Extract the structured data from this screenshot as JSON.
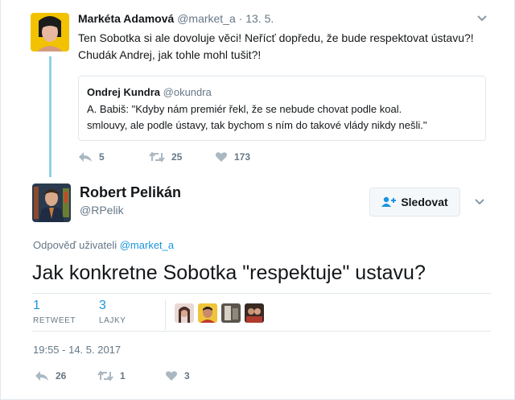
{
  "parent_tweet": {
    "author_name": "Markéta Adamová",
    "author_handle": "@market_a",
    "separator": "·",
    "date": "13. 5.",
    "text_line1": "Ten Sobotka si ale dovoluje věci! Neřícť dopředu, že bude respektovat ústavu?!",
    "text_line2": "Chudák Andrej, jak tohle mohl tušit?!",
    "quoted": {
      "author_name": "Ondrej Kundra",
      "author_handle": "@okundra",
      "text_line1": "A. Babiš: \"Kdyby nám premiér řekl, že se nebude chovat podle koal.",
      "text_line2": "smlouvy, ale podle ústavy, tak bychom s ním do takové vlády nikdy nešli.\""
    },
    "actions": {
      "replies": "5",
      "retweets": "25",
      "likes": "173"
    }
  },
  "main_tweet": {
    "author_name": "Robert Pelikán",
    "author_handle": "@RPelik",
    "follow_label": "Sledovat",
    "reply_prefix": "Odpověď uživateli",
    "reply_handle": "@market_a",
    "text": "Jak konkretne Sobotka \"respektuje\" ustavu?",
    "stats": {
      "retweets_count": "1",
      "retweets_label": "RETWEET",
      "likes_count": "3",
      "likes_label": "LAJKY"
    },
    "timestamp": "19:55 - 14. 5. 2017",
    "actions": {
      "replies": "26",
      "retweets": "1",
      "likes": "3"
    }
  },
  "icons": [
    "reply-icon",
    "retweet-icon",
    "heart-icon",
    "chevron-down-icon",
    "follow-user-icon"
  ],
  "colors": {
    "accent": "#1b95e0",
    "muted": "#657786",
    "thread_line": "#8ed0e8",
    "border": "#e1e8ed"
  }
}
